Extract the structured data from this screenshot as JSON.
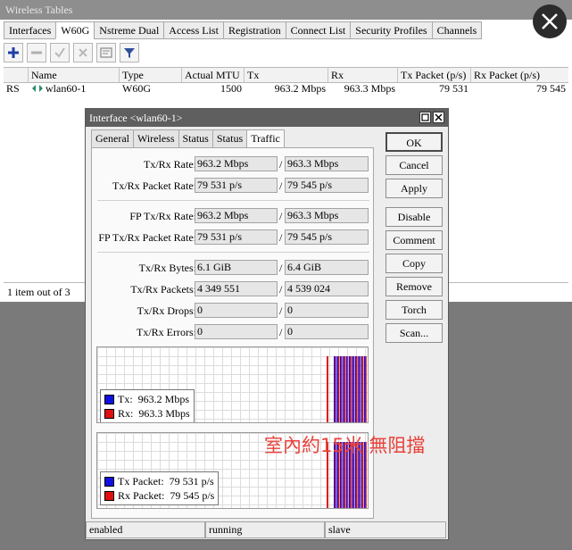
{
  "window": {
    "title": "Wireless Tables"
  },
  "tabs": [
    "Interfaces",
    "W60G",
    "Nstreme Dual",
    "Access List",
    "Registration",
    "Connect List",
    "Security Profiles",
    "Channels"
  ],
  "toolbar": {
    "icons": [
      "add-icon",
      "remove-icon",
      "enable-icon",
      "disable-icon",
      "comment-icon",
      "filter-icon"
    ]
  },
  "table": {
    "headers": [
      "",
      "Name",
      "Type",
      "Actual MTU",
      "Tx",
      "Rx",
      "Tx Packet (p/s)",
      "Rx Packet (p/s)"
    ],
    "rows": [
      {
        "flags": "RS",
        "name": "wlan60-1",
        "type": "W60G",
        "mtu": "1500",
        "tx": "963.2 Mbps",
        "rx": "963.3 Mbps",
        "tx_packet": "79 531",
        "rx_packet": "79 545"
      }
    ]
  },
  "status": {
    "count": "1 item out of 3"
  },
  "dialog": {
    "title": "Interface <wlan60-1>",
    "tabs": [
      "General",
      "Wireless",
      "Status",
      "Status",
      "Traffic"
    ],
    "fields": [
      {
        "label": "Tx/Rx Rate:",
        "tx": "963.2 Mbps",
        "rx": "963.3 Mbps"
      },
      {
        "label": "Tx/Rx Packet Rate:",
        "tx": "79 531 p/s",
        "rx": "79 545 p/s"
      },
      {
        "label": "FP Tx/Rx Rate:",
        "tx": "963.2 Mbps",
        "rx": "963.3 Mbps"
      },
      {
        "label": "FP Tx/Rx Packet Rate:",
        "tx": "79 531 p/s",
        "rx": "79 545 p/s"
      },
      {
        "label": "Tx/Rx Bytes:",
        "tx": "6.1 GiB",
        "rx": "6.4 GiB"
      },
      {
        "label": "Tx/Rx Packets:",
        "tx": "4 349 551",
        "rx": "4 539 024"
      },
      {
        "label": "Tx/Rx Drops:",
        "tx": "0",
        "rx": "0"
      },
      {
        "label": "Tx/Rx Errors:",
        "tx": "0",
        "rx": "0"
      }
    ],
    "separator": "/",
    "graph1": {
      "tx_label": "Tx:",
      "tx_value": "963.2 Mbps",
      "rx_label": "Rx:",
      "rx_value": "963.3 Mbps"
    },
    "graph2": {
      "tx_label": "Tx Packet:",
      "tx_value": "79 531 p/s",
      "rx_label": "Rx Packet:",
      "rx_value": "79 545 p/s"
    },
    "colors": {
      "tx": "#1010e0",
      "rx": "#e01010"
    },
    "buttons": [
      "OK",
      "Cancel",
      "Apply",
      "Disable",
      "Comment",
      "Copy",
      "Remove",
      "Torch",
      "Scan..."
    ],
    "status": [
      "enabled",
      "running",
      "slave"
    ]
  },
  "overlay": {
    "text": "室內約15米 無阻擋"
  }
}
